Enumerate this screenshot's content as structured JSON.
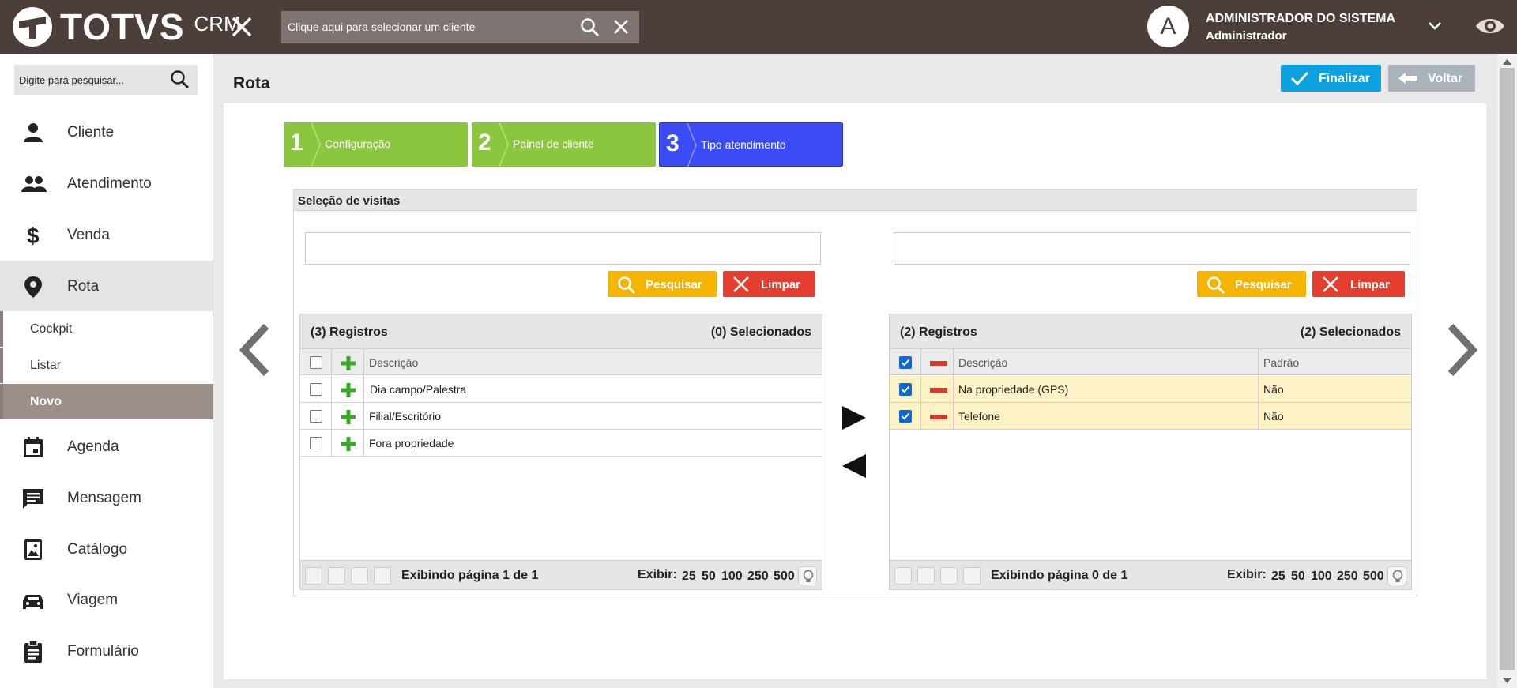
{
  "header": {
    "brand": "TOTVS",
    "product": "CRM",
    "client_search_placeholder": "Clique aqui para selecionar um cliente",
    "avatar_letter": "A",
    "user_name": "ADMINISTRADOR DO SISTEMA",
    "user_role": "Administrador"
  },
  "sidebar": {
    "search_placeholder": "Digite para pesquisar...",
    "items": [
      {
        "label": "Cliente",
        "icon": "person-icon"
      },
      {
        "label": "Atendimento",
        "icon": "people-icon"
      },
      {
        "label": "Venda",
        "icon": "dollar-icon"
      },
      {
        "label": "Rota",
        "icon": "location-pin-icon"
      },
      {
        "label": "Agenda",
        "icon": "calendar-icon"
      },
      {
        "label": "Mensagem",
        "icon": "message-icon"
      },
      {
        "label": "Catálogo",
        "icon": "image-book-icon"
      },
      {
        "label": "Viagem",
        "icon": "car-icon"
      },
      {
        "label": "Formulário",
        "icon": "clipboard-icon"
      }
    ],
    "subitems": [
      {
        "label": "Cockpit"
      },
      {
        "label": "Listar"
      },
      {
        "label": "Novo"
      }
    ]
  },
  "page": {
    "title": "Rota",
    "finish_label": "Finalizar",
    "back_label": "Voltar"
  },
  "steps": [
    {
      "num": "1",
      "label": "Configuração",
      "color": "#8cc63f"
    },
    {
      "num": "2",
      "label": "Painel de cliente",
      "color": "#8cc63f"
    },
    {
      "num": "3",
      "label": "Tipo atendimento",
      "color": "#3c4cf5"
    }
  ],
  "panel": {
    "title": "Seleção de visitas",
    "search_label": "Pesquisar",
    "clear_label": "Limpar"
  },
  "left_list": {
    "records": "(3) Registros",
    "selected": "(0) Selecionados",
    "col_desc": "Descrição",
    "rows": [
      {
        "desc": "Dia campo/Palestra"
      },
      {
        "desc": "Filial/Escritório"
      },
      {
        "desc": "Fora propriedade"
      }
    ],
    "page_info": "Exibindo página 1 de 1"
  },
  "right_list": {
    "records": "(2) Registros",
    "selected": "(2) Selecionados",
    "col_desc": "Descrição",
    "col_default": "Padrão",
    "rows": [
      {
        "desc": "Na propriedade (GPS)",
        "default": "Não"
      },
      {
        "desc": "Telefone",
        "default": "Não"
      }
    ],
    "page_info": "Exibindo página 0 de 1"
  },
  "pager": {
    "show_label": "Exibir:",
    "sizes": [
      "25",
      "50",
      "100",
      "250",
      "500"
    ]
  },
  "colors": {
    "topbar": "#4c3f39",
    "finish": "#0ea1e0",
    "back": "#a9b3b9",
    "search_btn": "#f5b400",
    "clear_btn": "#e53e2f",
    "step_done": "#8cc63f",
    "step_active": "#3c4cf5",
    "selected_row": "#fdf2c6"
  }
}
